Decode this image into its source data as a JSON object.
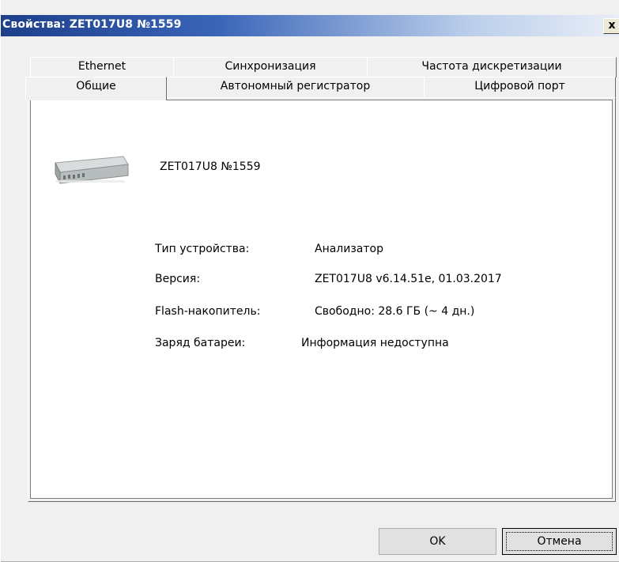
{
  "window": {
    "title": "Свойства: ZET017U8 №1559",
    "close_label": "x"
  },
  "tabs": {
    "row1": [
      {
        "label": "Ethernet"
      },
      {
        "label": "Синхронизация"
      },
      {
        "label": "Частота дискретизации"
      }
    ],
    "row2": [
      {
        "label": "Общие",
        "active": true
      },
      {
        "label": "Автономный регистратор"
      },
      {
        "label": "Цифровой порт"
      }
    ]
  },
  "general": {
    "device_name": "ZET017U8 №1559",
    "properties": [
      {
        "label": "Тип устройства:",
        "value": "Анализатор"
      },
      {
        "label": "Версия:",
        "value": "ZET017U8 v6.14.51e, 01.03.2017"
      },
      {
        "label": "Flash-накопитель:",
        "value": "Свободно: 28.6 ГБ (~ 4 дн.)"
      },
      {
        "label": "Заряд батареи:",
        "value": "Информация недоступна"
      }
    ]
  },
  "buttons": {
    "ok": "OK",
    "cancel": "Отмена"
  }
}
